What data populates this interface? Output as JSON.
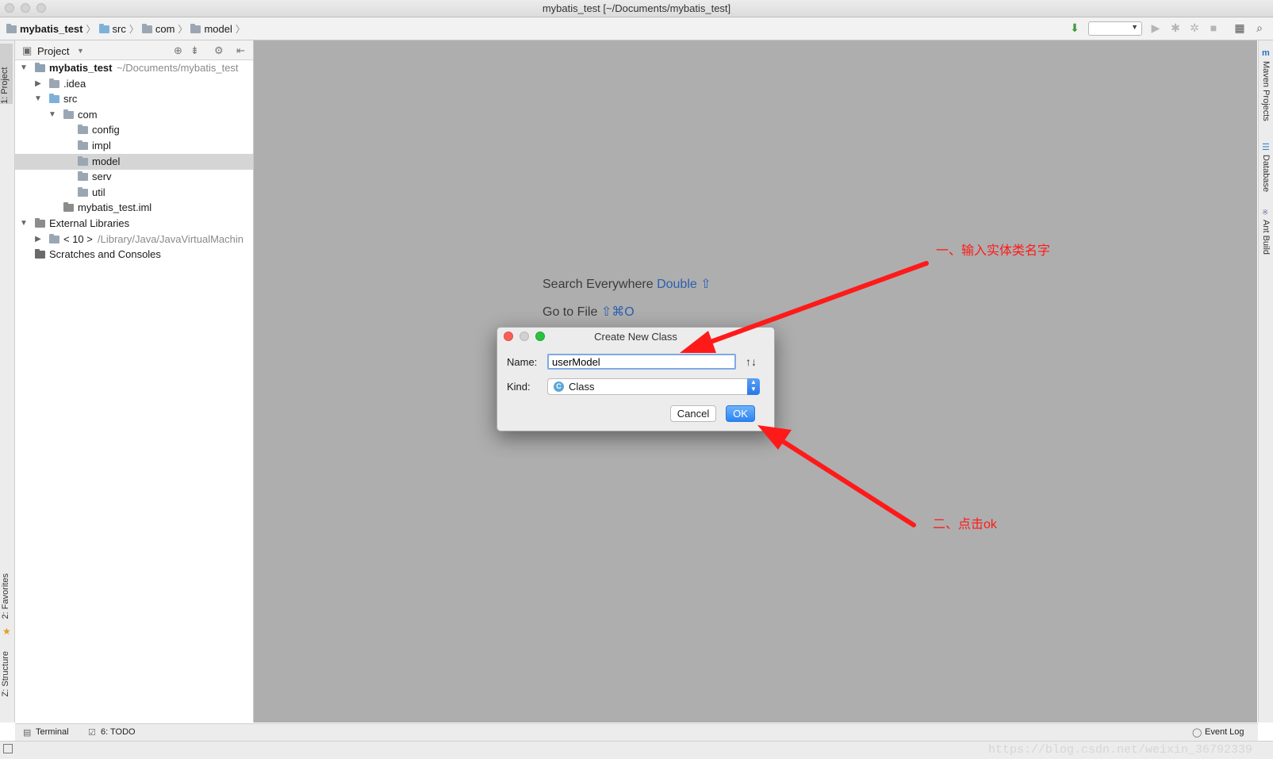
{
  "window": {
    "title": "mybatis_test [~/Documents/mybatis_test]"
  },
  "breadcrumb": [
    "mybatis_test",
    "src",
    "com",
    "model"
  ],
  "sidebar_tabs": {
    "project": "1: Project",
    "favorites": "2: Favorites",
    "structure": "Z: Structure"
  },
  "right_tabs": {
    "maven": "Maven Projects",
    "database": "Database",
    "ant": "Ant Build"
  },
  "project_panel": {
    "header": "Project",
    "tree": [
      {
        "label": "mybatis_test",
        "suffix": "~/Documents/mybatis_test",
        "indent": 0,
        "expanded": true,
        "icon": "module-folder-icon",
        "bold": true
      },
      {
        "label": ".idea",
        "indent": 1,
        "expanded": false,
        "icon": "folder-icon"
      },
      {
        "label": "src",
        "indent": 1,
        "expanded": true,
        "icon": "source-folder-icon"
      },
      {
        "label": "com",
        "indent": 2,
        "expanded": true,
        "icon": "package-icon"
      },
      {
        "label": "config",
        "indent": 3,
        "icon": "package-icon"
      },
      {
        "label": "impl",
        "indent": 3,
        "icon": "package-icon"
      },
      {
        "label": "model",
        "indent": 3,
        "icon": "package-icon",
        "selected": true
      },
      {
        "label": "serv",
        "indent": 3,
        "icon": "package-icon"
      },
      {
        "label": "util",
        "indent": 3,
        "icon": "package-icon"
      },
      {
        "label": "mybatis_test.iml",
        "indent": 2,
        "icon": "iml-file-icon"
      },
      {
        "label": "External Libraries",
        "indent": 0,
        "expanded": true,
        "icon": "library-icon"
      },
      {
        "label": "< 10 >",
        "suffix": "/Library/Java/JavaVirtualMachin",
        "indent": 1,
        "expanded": false,
        "icon": "jdk-folder-icon"
      },
      {
        "label": "Scratches and Consoles",
        "indent": 0,
        "icon": "scratches-icon"
      }
    ]
  },
  "editor_hints": {
    "search_label": "Search Everywhere",
    "search_key": "Double ⇧",
    "goto_label": "Go to File",
    "goto_key": "⇧⌘O"
  },
  "dialog": {
    "title": "Create New Class",
    "name_label": "Name:",
    "name_value": "userModel",
    "kind_label": "Kind:",
    "kind_value": "Class",
    "sort_icon_text": "↑↓",
    "cancel": "Cancel",
    "ok": "OK"
  },
  "annotations": {
    "step1": "一、输入实体类名字",
    "step2": "二、点击ok",
    "color": "#ff1a1a"
  },
  "bottom_tabs": {
    "terminal": "Terminal",
    "todo": "6: TODO",
    "event_log": "Event Log"
  },
  "watermark": "https://blog.csdn.net/weixin_36792339"
}
